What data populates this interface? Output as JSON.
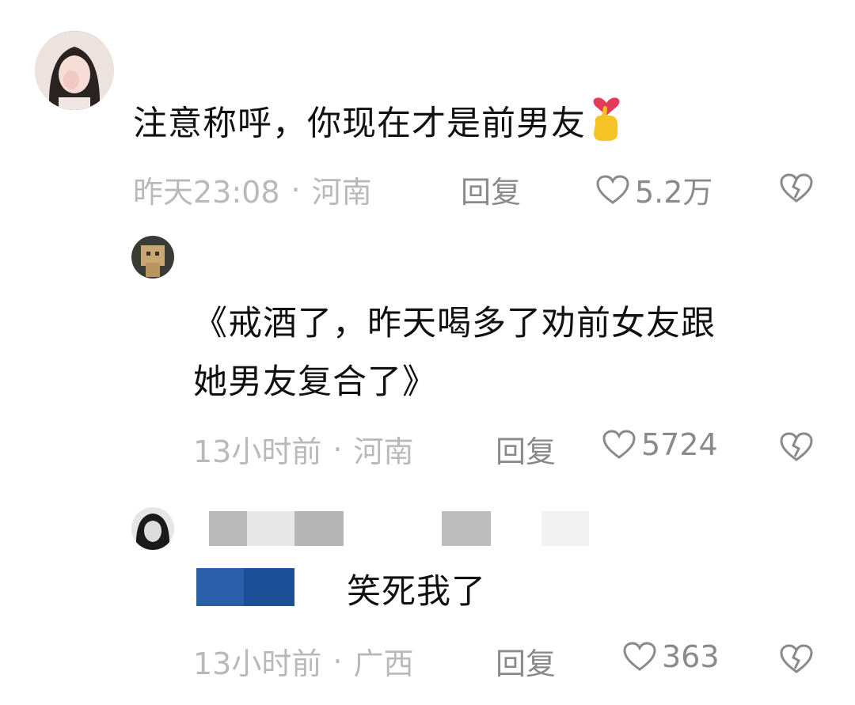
{
  "comments": [
    {
      "text": "注意称呼，你现在才是前男友",
      "emoji": "🫰",
      "time": "昨天23:08",
      "location": "河南",
      "reply_label": "回复",
      "likes": "5.2万"
    },
    {
      "text_line1": "《戒酒了，昨天喝多了劝前女友跟",
      "text_line2": "她男友复合了》",
      "time": "13小时前",
      "location": "河南",
      "reply_label": "回复",
      "likes": "5724"
    },
    {
      "text": "笑死我了",
      "time": "13小时前",
      "location": "广西",
      "reply_label": "回复",
      "likes": "363"
    }
  ],
  "separator": "·",
  "icons": {
    "like": "heart-outline-icon",
    "dislike": "broken-heart-icon"
  },
  "colors": {
    "meta": "#b9b9b9",
    "action": "#8a8a8a",
    "text": "#111111",
    "mosaic_blue": "#1f55a0"
  }
}
